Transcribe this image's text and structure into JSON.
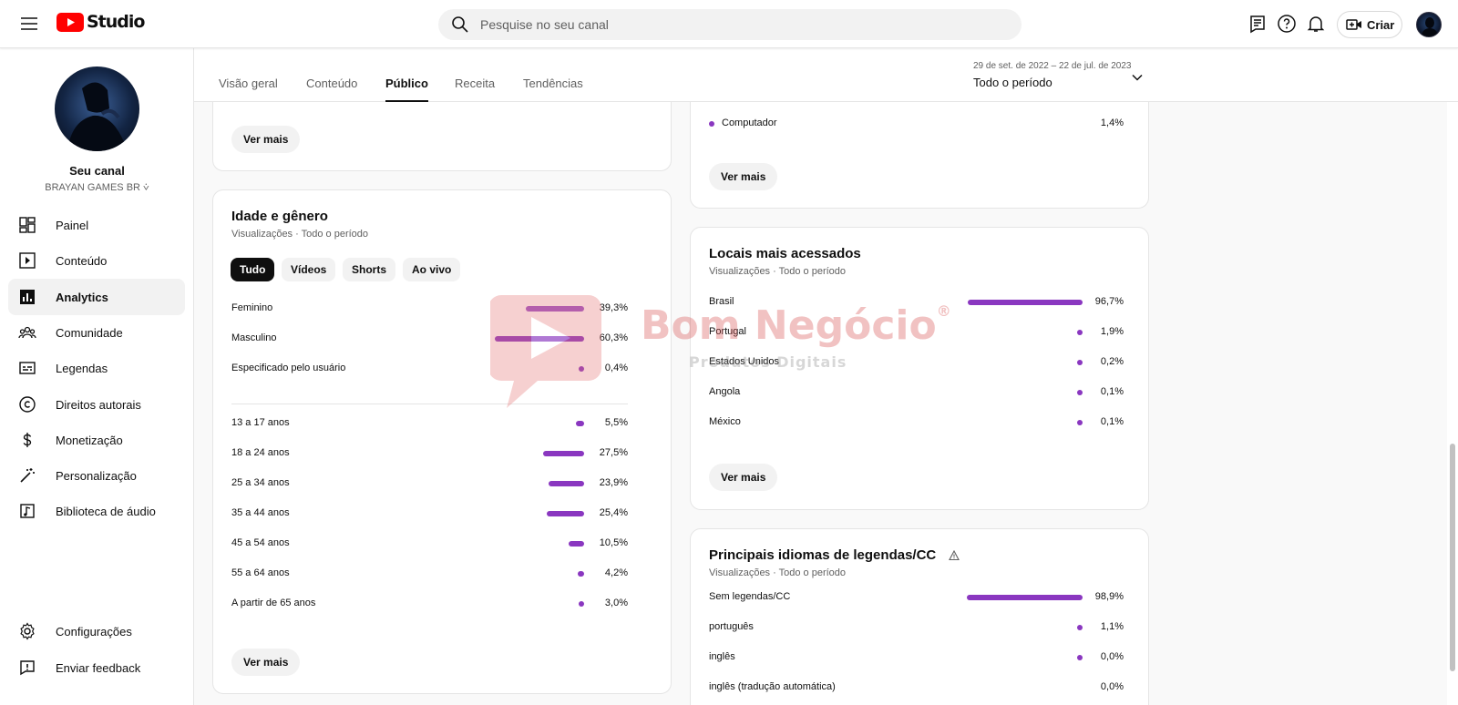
{
  "header": {
    "logo_text": "Studio",
    "search_placeholder": "Pesquise no seu canal",
    "create_label": "Criar",
    "icons": [
      "menu-icon",
      "youtube-logo-icon",
      "search-icon",
      "subtitles-icon",
      "help-icon",
      "bell-icon",
      "create-video-icon"
    ]
  },
  "sidebar": {
    "channel_title": "Seu canal",
    "channel_name": "BRAYAN GAMES BR ⩒",
    "items": [
      {
        "label": "Painel",
        "icon": "dashboard-icon"
      },
      {
        "label": "Conteúdo",
        "icon": "content-icon"
      },
      {
        "label": "Analytics",
        "icon": "analytics-icon",
        "active": true
      },
      {
        "label": "Comunidade",
        "icon": "community-icon"
      },
      {
        "label": "Legendas",
        "icon": "subtitles-icon"
      },
      {
        "label": "Direitos autorais",
        "icon": "copyright-icon"
      },
      {
        "label": "Monetização",
        "icon": "dollar-icon"
      },
      {
        "label": "Personalização",
        "icon": "magic-wand-icon"
      },
      {
        "label": "Biblioteca de áudio",
        "icon": "audio-library-icon"
      }
    ],
    "bottom_items": [
      {
        "label": "Configurações",
        "icon": "gear-icon"
      },
      {
        "label": "Enviar feedback",
        "icon": "feedback-icon"
      }
    ]
  },
  "tabs": [
    {
      "label": "Visão geral"
    },
    {
      "label": "Conteúdo"
    },
    {
      "label": "Público",
      "active": true
    },
    {
      "label": "Receita"
    },
    {
      "label": "Tendências"
    }
  ],
  "date_picker": {
    "range": "29 de set. de 2022 – 22 de jul. de 2023",
    "value": "Todo o período"
  },
  "card_top_left": {
    "more_label": "Ver mais"
  },
  "card_device": {
    "rows": [
      {
        "label": "Computador",
        "value": "1,4%",
        "percent": 1.4
      }
    ],
    "more_label": "Ver mais"
  },
  "card_age_gender": {
    "title": "Idade e gênero",
    "subtitle": "Visualizações · Todo o período",
    "filters": [
      "Tudo",
      "Vídeos",
      "Shorts",
      "Ao vivo"
    ],
    "active_filter": "Tudo",
    "gender": [
      {
        "label": "Feminino",
        "value": "39,3%",
        "percent": 39.3
      },
      {
        "label": "Masculino",
        "value": "60,3%",
        "percent": 60.3
      },
      {
        "label": "Especificado pelo usuário",
        "value": "0,4%",
        "percent": 0.4
      }
    ],
    "age": [
      {
        "label": "13 a 17 anos",
        "value": "5,5%",
        "percent": 5.5
      },
      {
        "label": "18 a 24 anos",
        "value": "27,5%",
        "percent": 27.5
      },
      {
        "label": "25 a 34 anos",
        "value": "23,9%",
        "percent": 23.9
      },
      {
        "label": "35 a 44 anos",
        "value": "25,4%",
        "percent": 25.4
      },
      {
        "label": "45 a 54 anos",
        "value": "10,5%",
        "percent": 10.5
      },
      {
        "label": "55 a 64 anos",
        "value": "4,2%",
        "percent": 4.2
      },
      {
        "label": "A partir de 65 anos",
        "value": "3,0%",
        "percent": 3.0
      }
    ],
    "more_label": "Ver mais"
  },
  "card_locations": {
    "title": "Locais mais acessados",
    "subtitle": "Visualizações · Todo o período",
    "rows": [
      {
        "label": "Brasil",
        "value": "96,7%",
        "percent": 96.7
      },
      {
        "label": "Portugal",
        "value": "1,9%",
        "percent": 1.9
      },
      {
        "label": "Estados Unidos",
        "value": "0,2%",
        "percent": 0.2
      },
      {
        "label": "Angola",
        "value": "0,1%",
        "percent": 0.1
      },
      {
        "label": "México",
        "value": "0,1%",
        "percent": 0.1
      }
    ],
    "more_label": "Ver mais"
  },
  "card_languages": {
    "title": "Principais idiomas de legendas/CC",
    "subtitle": "Visualizações · Todo o período",
    "rows": [
      {
        "label": "Sem legendas/CC",
        "value": "98,9%",
        "percent": 98.9
      },
      {
        "label": "português",
        "value": "1,1%",
        "percent": 1.1
      },
      {
        "label": "inglês",
        "value": "0,0%",
        "percent": 0.0
      },
      {
        "label": "inglês (tradução automática)",
        "value": "0,0%",
        "percent": 0.0
      }
    ]
  },
  "watermark": {
    "title": "Bom Negócio",
    "registered": "®",
    "subtitle": "Produtos Digitais"
  }
}
